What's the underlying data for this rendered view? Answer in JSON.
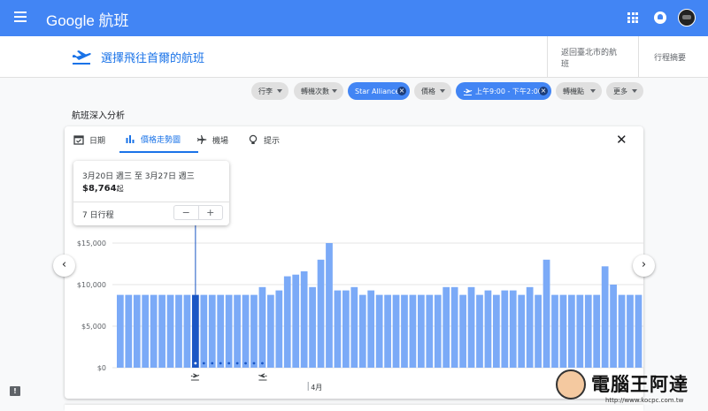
{
  "app": {
    "brand": "Google 航班"
  },
  "header": {
    "route_title": "選擇飛往首爾的航班",
    "crumbs": [
      "返回臺北市的航班",
      "行程摘要"
    ]
  },
  "filters": [
    {
      "label": "行李",
      "active": false
    },
    {
      "label": "轉機次數",
      "active": false
    },
    {
      "label": "Star Alliance",
      "active": true
    },
    {
      "label": "價格",
      "active": false
    },
    {
      "label": "上午9:00 - 下午2:00",
      "active": true
    },
    {
      "label": "轉機點",
      "active": false
    },
    {
      "label": "更多",
      "active": false
    }
  ],
  "insights": {
    "section_title": "航班深入分析",
    "tabs": [
      {
        "label": "日期",
        "icon": "calendar-icon",
        "active": false
      },
      {
        "label": "價格走勢圖",
        "icon": "bar-chart-icon",
        "active": true
      },
      {
        "label": "機場",
        "icon": "plane-icon",
        "active": false
      },
      {
        "label": "提示",
        "icon": "lightbulb-icon",
        "active": false
      }
    ]
  },
  "tooltip": {
    "dates": "3月20日 週三 至 3月27日 週三",
    "price": "$8,764",
    "price_suffix": "起",
    "trip_length_label": "7 日行程",
    "minus": "−",
    "plus": "+"
  },
  "colors": {
    "bar": "#7baaf7",
    "bar_selected": "#1a56c4",
    "accent": "#4285f4"
  },
  "watermark": {
    "text": "電腦王阿達",
    "url": "http://www.kocpc.com.tw"
  },
  "chart_data": {
    "type": "bar",
    "ylabels": [
      "$15,000",
      "$10,000",
      "$5,000",
      "$0"
    ],
    "yticks": [
      15000,
      10000,
      5000,
      0
    ],
    "ylim": [
      0,
      15000
    ],
    "month_label": "4月",
    "month_label_index": 23,
    "selected_index": 9,
    "dot_indices": [
      10,
      11,
      12,
      13,
      14,
      15,
      16,
      17
    ],
    "depart_marker_index": 9,
    "return_marker_index": 17,
    "values": [
      8764,
      8764,
      8764,
      8764,
      8764,
      8764,
      8764,
      8764,
      8764,
      8764,
      8764,
      8764,
      8764,
      8764,
      8764,
      8764,
      8764,
      9700,
      8764,
      9300,
      11000,
      11200,
      11600,
      9700,
      13000,
      15000,
      9300,
      9300,
      9700,
      8764,
      9300,
      8764,
      8764,
      8764,
      8764,
      8764,
      8764,
      8764,
      8764,
      9700,
      9700,
      8764,
      9700,
      8764,
      9300,
      8764,
      9300,
      9300,
      8764,
      9700,
      8764,
      13000,
      8764,
      8764,
      8764,
      8764,
      8764,
      8764,
      12200,
      10000,
      8764,
      8764,
      8764
    ]
  }
}
